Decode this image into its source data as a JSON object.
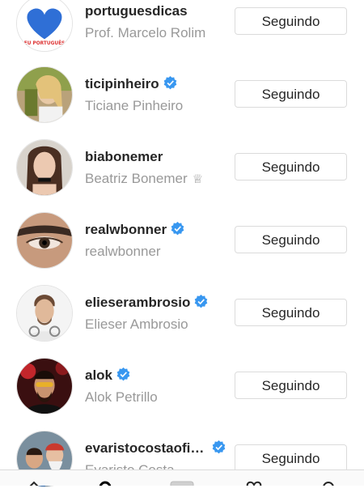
{
  "following": [
    {
      "username": "portuguesdicas",
      "full_name": "Prof. Marcelo Rolim",
      "verified": false,
      "button": "Seguindo",
      "avatar_icon": "heart-flag-logo",
      "avatar_text": "EU PORTUGUÊS"
    },
    {
      "username": "ticipinheiro",
      "full_name": "Ticiane Pinheiro",
      "verified": true,
      "button": "Seguindo",
      "avatar_icon": "person-photo"
    },
    {
      "username": "biabonemer",
      "full_name": "Beatriz Bonemer",
      "verified": false,
      "button": "Seguindo",
      "avatar_icon": "person-photo",
      "name_emoji": "♕"
    },
    {
      "username": "realwbonner",
      "full_name": "realwbonner",
      "verified": true,
      "button": "Seguindo",
      "avatar_icon": "eye-closeup-photo"
    },
    {
      "username": "elieserambrosio",
      "full_name": "Elieser Ambrosio",
      "verified": true,
      "button": "Seguindo",
      "avatar_icon": "person-photo"
    },
    {
      "username": "alok",
      "full_name": "Alok Petrillo",
      "verified": true,
      "button": "Seguindo",
      "avatar_icon": "dj-photo"
    },
    {
      "username": "evaristocostaofi…",
      "full_name": "Evaristo Costa",
      "verified": true,
      "button": "Seguindo",
      "avatar_icon": "group-photo"
    }
  ],
  "bottom_nav": [
    "home-icon",
    "search-icon",
    "add-post-icon",
    "activity-heart-icon",
    "profile-icon"
  ],
  "colors": {
    "verified": "#3897f0",
    "text": "#262626",
    "secondary": "#999999",
    "border": "#dbdbdb"
  }
}
